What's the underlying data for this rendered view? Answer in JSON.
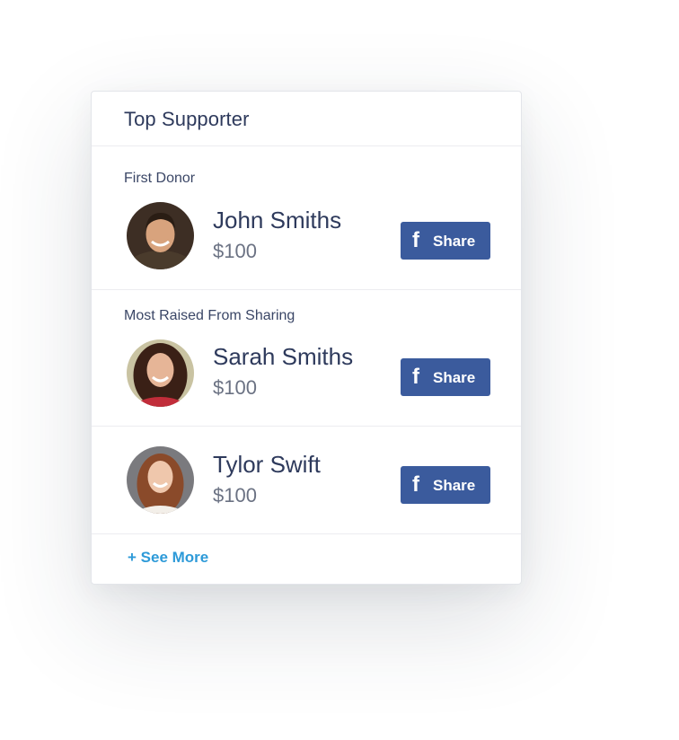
{
  "card": {
    "title": "Top Supporter"
  },
  "sections": [
    {
      "label": "First Donor",
      "name": "John Smiths",
      "amount": "$100",
      "share_label": "Share",
      "share_icon": "facebook-f"
    },
    {
      "label": "Most Raised From Sharing",
      "name": "Sarah Smiths",
      "amount": "$100",
      "share_label": "Share",
      "share_icon": "facebook-f"
    },
    {
      "label": "",
      "name": "Tylor Swift",
      "amount": "$100",
      "share_label": "Share",
      "share_icon": "facebook-f"
    }
  ],
  "see_more": "+ See More",
  "colors": {
    "title": "#2e3a5c",
    "amount": "#6b7283",
    "facebook": "#3b5b9d",
    "link": "#2d9ad8",
    "divider": "#ececf0"
  }
}
